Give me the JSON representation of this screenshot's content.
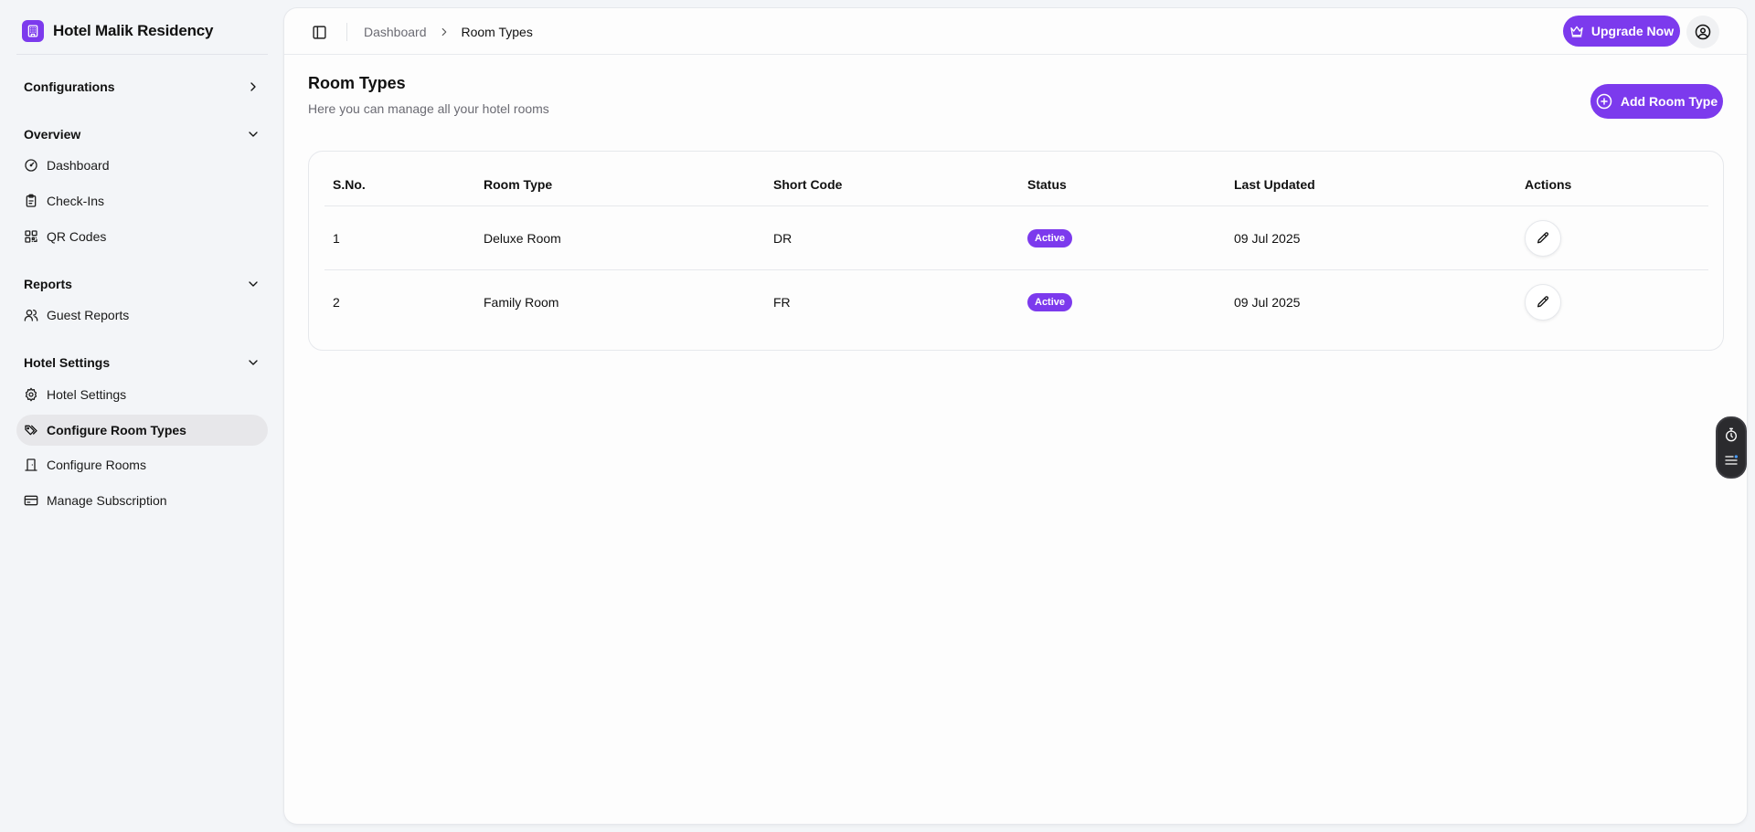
{
  "brand": {
    "name": "Hotel Malik Residency",
    "icon": "building-icon"
  },
  "colors": {
    "accent": "#7c3aed",
    "sidebar_bg": "#f3f5f8",
    "active_item_bg": "#e7e7ea"
  },
  "sidebar": {
    "configurations": {
      "label": "Configurations",
      "icon": "chevron-right-icon"
    },
    "groups": [
      {
        "label": "Overview",
        "items": [
          {
            "label": "Dashboard",
            "icon": "gauge-icon"
          },
          {
            "label": "Check-Ins",
            "icon": "clipboard-icon"
          },
          {
            "label": "QR Codes",
            "icon": "qr-code-icon"
          }
        ]
      },
      {
        "label": "Reports",
        "items": [
          {
            "label": "Guest Reports",
            "icon": "users-icon"
          }
        ]
      },
      {
        "label": "Hotel Settings",
        "items": [
          {
            "label": "Hotel Settings",
            "icon": "gear-icon"
          },
          {
            "label": "Configure Room Types",
            "icon": "tags-icon",
            "active": true
          },
          {
            "label": "Configure Rooms",
            "icon": "door-icon"
          },
          {
            "label": "Manage Subscription",
            "icon": "credit-card-icon"
          }
        ]
      }
    ]
  },
  "topbar": {
    "breadcrumb": [
      "Dashboard",
      "Room Types"
    ],
    "upgrade_label": "Upgrade Now"
  },
  "page": {
    "title": "Room Types",
    "subtitle": "Here you can manage all your hotel rooms",
    "add_label": "Add Room Type"
  },
  "table": {
    "headers": [
      "S.No.",
      "Room Type",
      "Short Code",
      "Status",
      "Last Updated",
      "Actions"
    ],
    "rows": [
      {
        "sno": "1",
        "room_type": "Deluxe Room",
        "short_code": "DR",
        "status": "Active",
        "last_updated": "09 Jul 2025"
      },
      {
        "sno": "2",
        "room_type": "Family Room",
        "short_code": "FR",
        "status": "Active",
        "last_updated": "09 Jul 2025"
      }
    ]
  }
}
